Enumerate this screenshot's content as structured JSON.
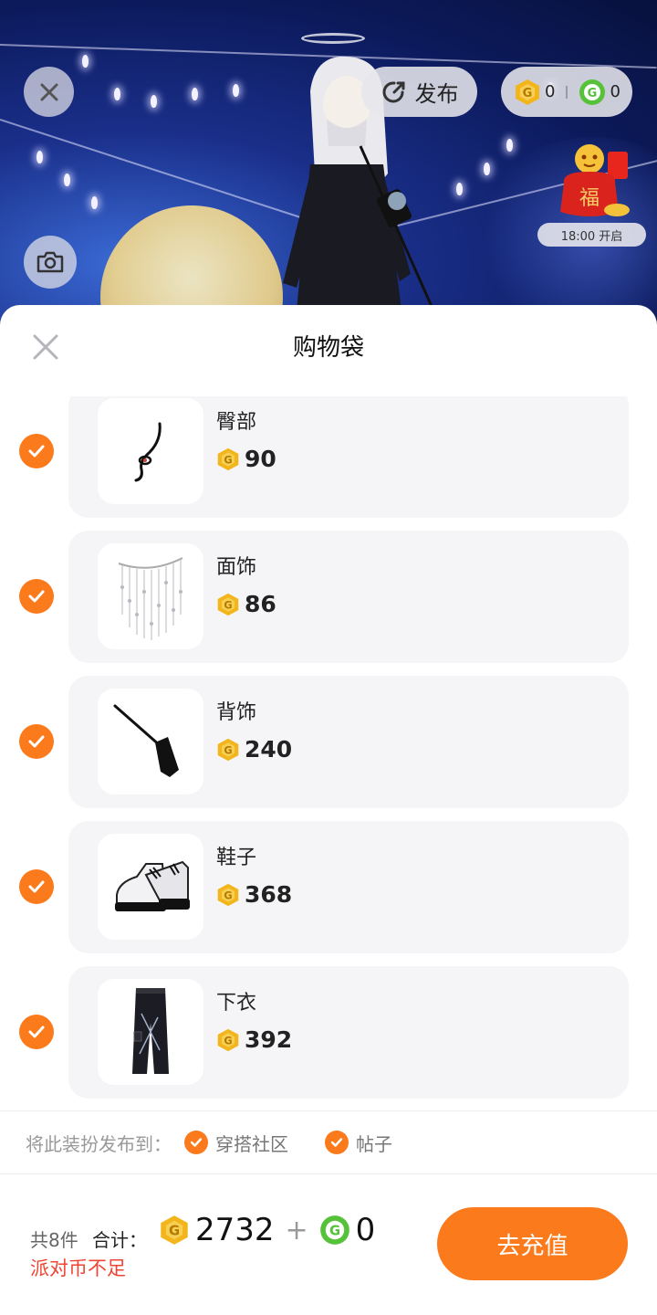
{
  "scene": {
    "publish_label": "发布",
    "coins": {
      "gold": "0",
      "green": "0"
    },
    "event_time": "18:00 开启",
    "event_icon_text": "福"
  },
  "sheet": {
    "title": "购物袋",
    "items": [
      {
        "name": "臀部",
        "price": "90",
        "icon": "chain-accessory-icon"
      },
      {
        "name": "面饰",
        "price": "86",
        "icon": "bead-veil-icon"
      },
      {
        "name": "背饰",
        "price": "240",
        "icon": "crossbody-bag-icon"
      },
      {
        "name": "鞋子",
        "price": "368",
        "icon": "platform-boots-icon"
      },
      {
        "name": "下衣",
        "price": "392",
        "icon": "cargo-pants-icon"
      }
    ],
    "publish_to": {
      "label": "将此装扮发布到：",
      "options": [
        "穿搭社区",
        "帖子"
      ]
    },
    "footer": {
      "count": "共8件",
      "total_label": "合计：",
      "total_gold": "2732",
      "plus": "+",
      "total_green": "0",
      "warning": "派对币不足",
      "recharge_label": "去充值"
    }
  },
  "colors": {
    "accent": "#fb7a1c",
    "warning": "#f04433",
    "gold_coin": "#f2b61c",
    "green_coin": "#55c23a"
  }
}
